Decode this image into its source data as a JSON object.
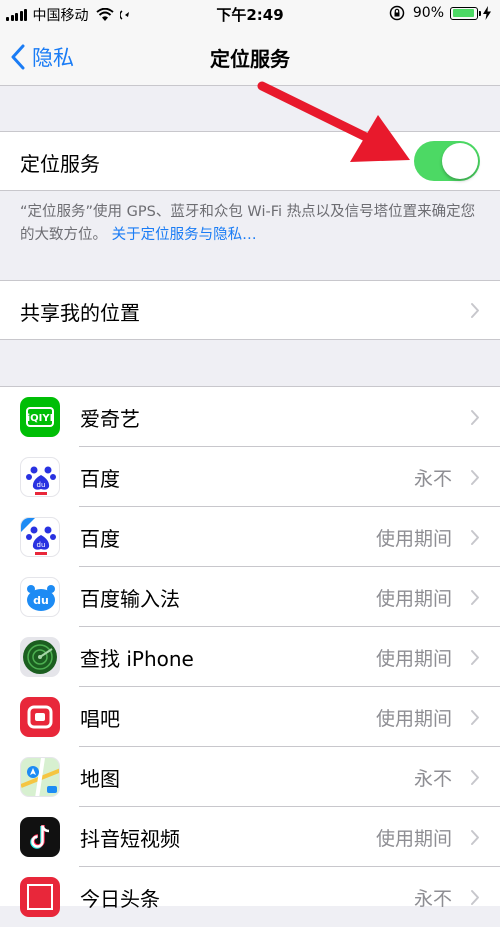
{
  "status_bar": {
    "carrier": "中国移动",
    "time": "下午2:49",
    "battery_percent": "90%",
    "battery_level": 0.9
  },
  "nav": {
    "back_label": "隐私",
    "title": "定位服务"
  },
  "location_services": {
    "label": "定位服务",
    "toggle_on": true,
    "footnote": "“定位服务”使用 GPS、蓝牙和众包 Wi-Fi 热点以及信号塔位置来确定您的大致方位。",
    "footnote_link": "关于定位服务与隐私…"
  },
  "share_location": {
    "label": "共享我的位置"
  },
  "apps": [
    {
      "name": "爱奇艺",
      "status": "",
      "icon": "iqiyi-icon",
      "color": "#00be06"
    },
    {
      "name": "百度",
      "status": "永不",
      "icon": "baidu-icon",
      "color": "#2932e1"
    },
    {
      "name": "百度",
      "status": "使用期间",
      "icon": "baidu-icon",
      "color": "#2932e1"
    },
    {
      "name": "百度输入法",
      "status": "使用期间",
      "icon": "baidu-input-icon",
      "color": "#1d8bf4"
    },
    {
      "name": "查找 iPhone",
      "status": "使用期间",
      "icon": "find-iphone-icon",
      "color": "#2e7d32"
    },
    {
      "name": "唱吧",
      "status": "使用期间",
      "icon": "changba-icon",
      "color": "#e8273a"
    },
    {
      "name": "地图",
      "status": "永不",
      "icon": "maps-icon",
      "color": "#4cd964"
    },
    {
      "name": "抖音短视频",
      "status": "使用期间",
      "icon": "douyin-icon",
      "color": "#111111"
    },
    {
      "name": "今日头条",
      "status": "永不",
      "icon": "toutiao-icon",
      "color": "#e8273a"
    }
  ],
  "colors": {
    "accent": "#1a7cf5",
    "toggle_on": "#4cd964",
    "annotation_arrow": "#e8192c"
  }
}
